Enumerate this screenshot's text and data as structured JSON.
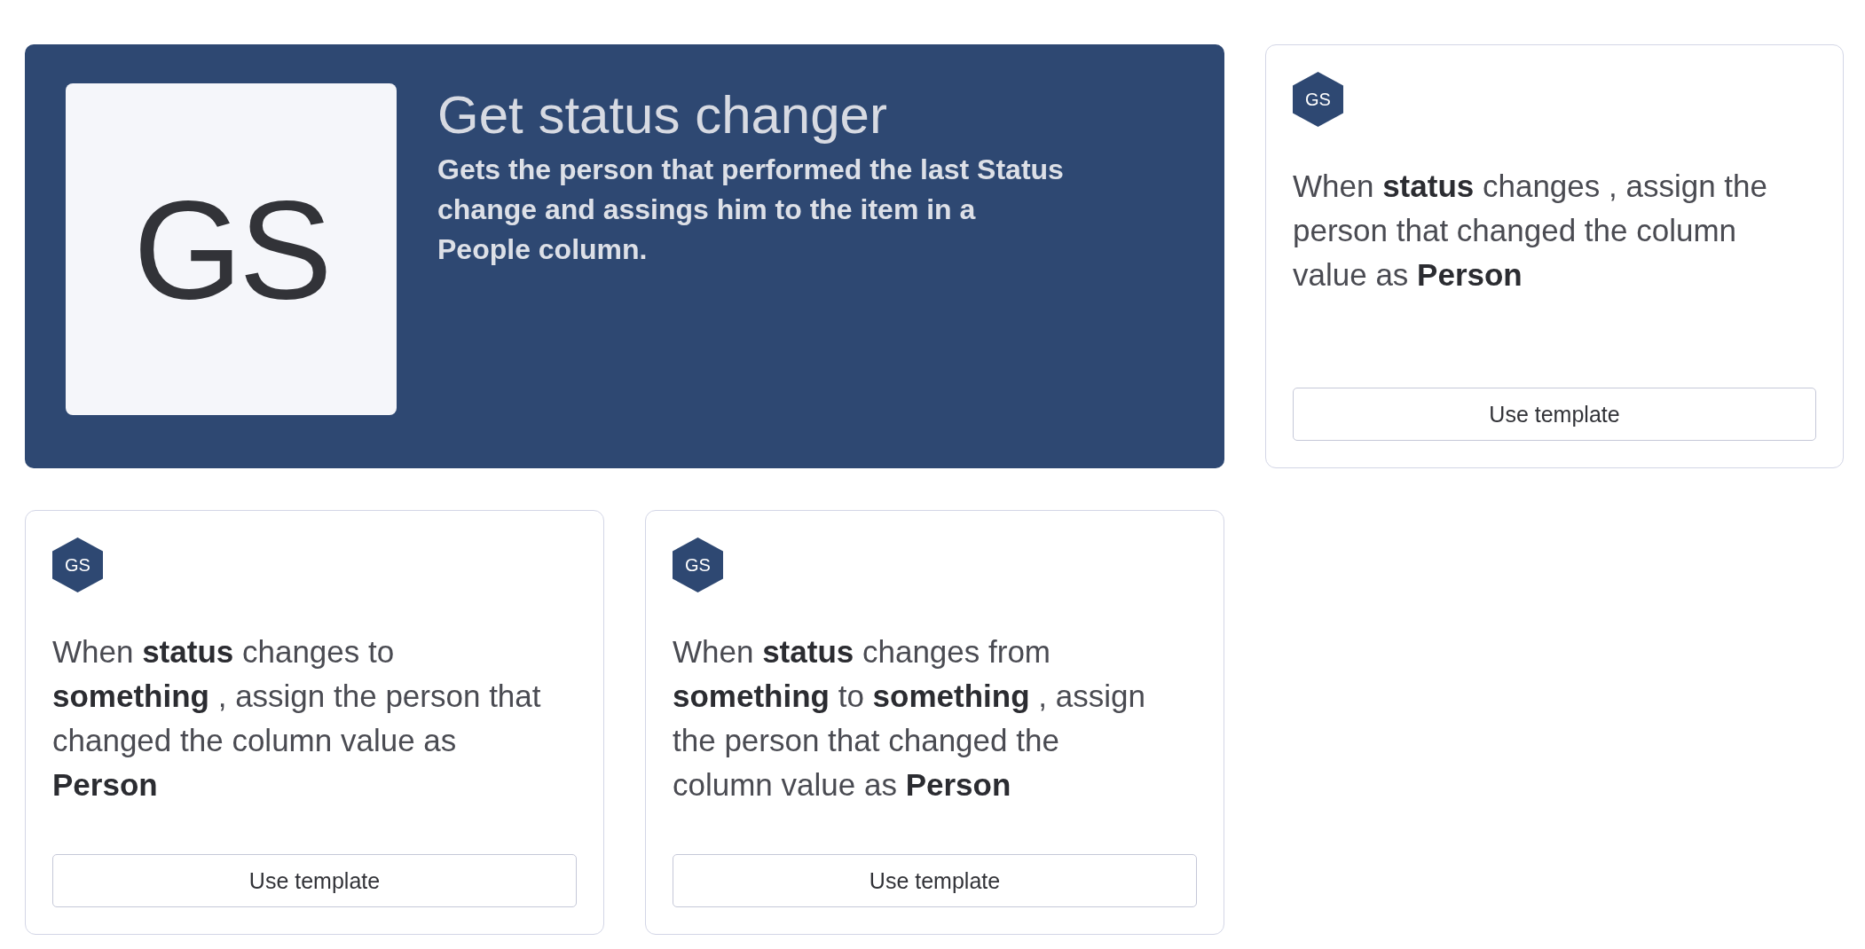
{
  "hero": {
    "logo_text": "GS",
    "title": "Get status changer",
    "description": "Gets the person that performed the last Status change and assings him to the item in a People column."
  },
  "templates": [
    {
      "badge": "GS",
      "sentence": "When **status** changes , assign the person that changed the column value as **Person**",
      "button": "Use template"
    },
    {
      "badge": "GS",
      "sentence": "When **status** changes to **something** , assign the person that changed the column value as **Person**",
      "button": "Use template"
    },
    {
      "badge": "GS",
      "sentence": "When **status** changes from **something** to **something** , assign the person that changed the column value as **Person**",
      "button": "Use template"
    }
  ]
}
